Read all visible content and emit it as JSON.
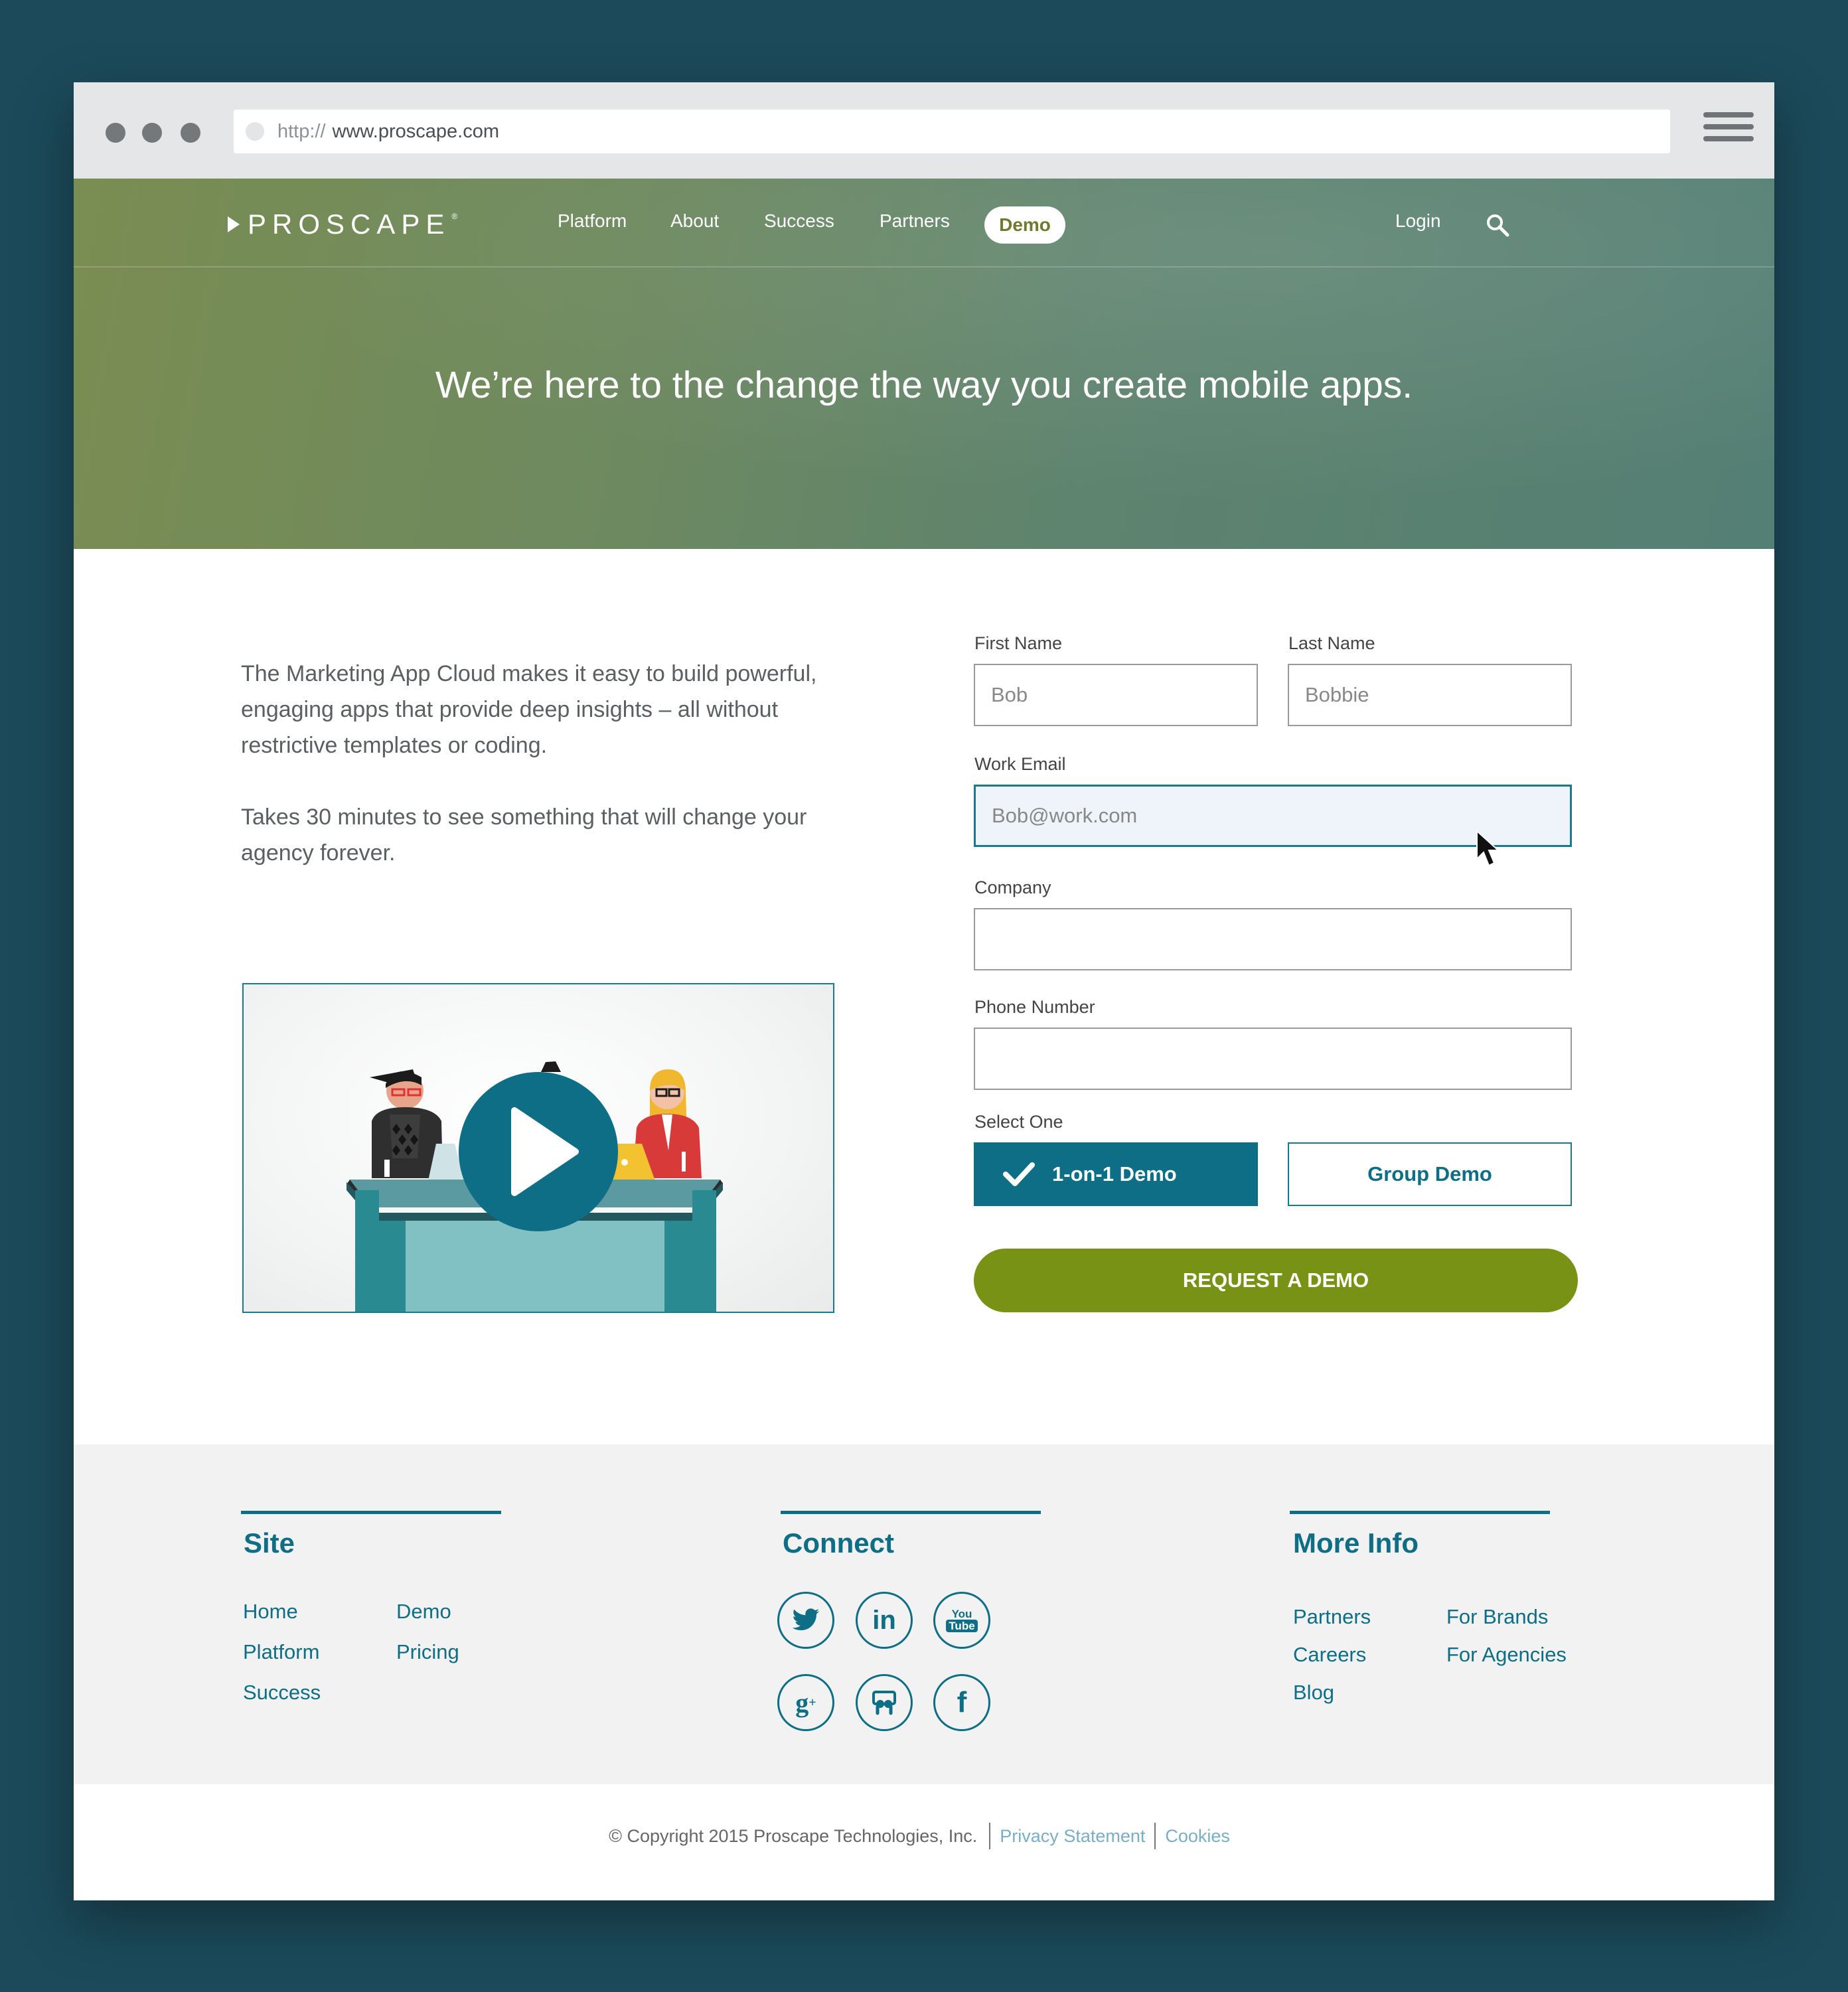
{
  "browser": {
    "url_protocol": "http://",
    "url_host": "www.proscape.com"
  },
  "nav": {
    "logo": "PROSCAPE",
    "logo_mark": "®",
    "items": [
      "Platform",
      "About",
      "Success",
      "Partners"
    ],
    "demo": "Demo",
    "login": "Login"
  },
  "hero": {
    "title": "We’re here to the change the way you create mobile apps."
  },
  "intro": {
    "paragraph1": "The Marketing App Cloud makes it easy to build powerful, engaging apps that provide deep insights – all without restrictive templates or coding.",
    "paragraph2": "Takes 30 minutes to see something that will change your agency forever."
  },
  "form": {
    "first_name_label": "First Name",
    "first_name_value": "Bob",
    "last_name_label": "Last Name",
    "last_name_value": "Bobbie",
    "email_label": "Work Email",
    "email_value": "Bob@work.com",
    "company_label": "Company",
    "company_value": "",
    "phone_label": "Phone Number",
    "phone_value": "",
    "select_label": "Select One",
    "option_1on1": "1-on-1 Demo",
    "option_group": "Group Demo",
    "submit": "REQUEST A DEMO"
  },
  "footer": {
    "site": {
      "title": "Site",
      "links": [
        "Home",
        "Platform",
        "Success",
        "Demo",
        "Pricing"
      ]
    },
    "connect": {
      "title": "Connect",
      "icons": [
        "twitter-icon",
        "linkedin-icon",
        "youtube-icon",
        "google-plus-icon",
        "slideshare-icon",
        "facebook-icon"
      ]
    },
    "more_info": {
      "title": "More Info",
      "links": [
        "Partners",
        "Careers",
        "Blog",
        "For Brands",
        "For Agencies"
      ]
    },
    "copyright": "© Copyright 2015 Proscape Technologies, Inc.",
    "privacy": "Privacy Statement",
    "cookies": "Cookies"
  },
  "colors": {
    "accent": "#0d6e85",
    "submit": "#779214",
    "background": "#1c4a5a"
  }
}
